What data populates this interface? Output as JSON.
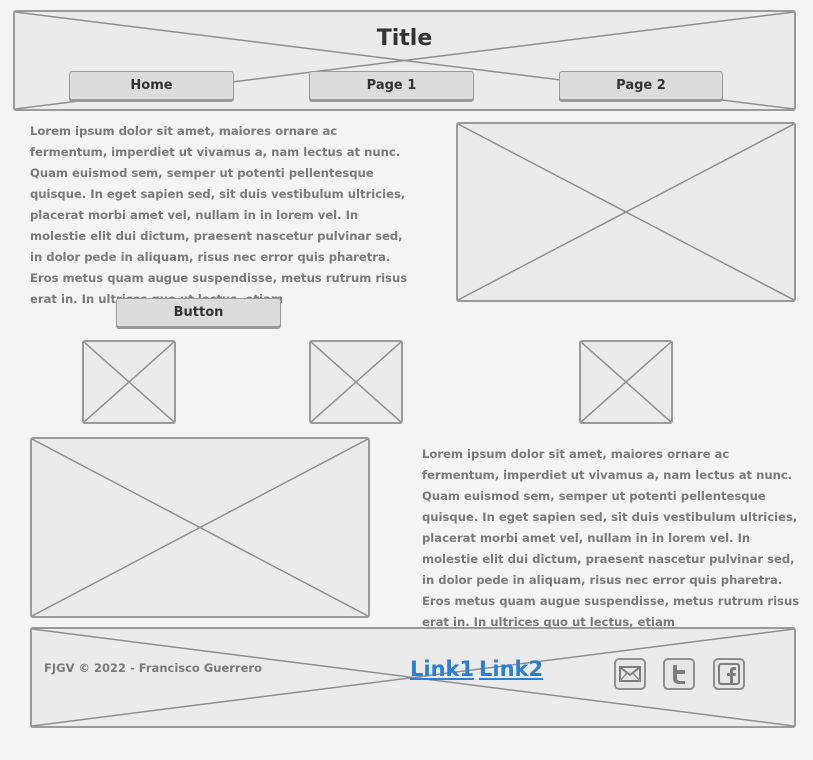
{
  "header": {
    "title": "Title",
    "nav": [
      {
        "label": "Home"
      },
      {
        "label": "Page 1"
      },
      {
        "label": "Page 2"
      }
    ]
  },
  "main": {
    "paragraph_top": "Lorem ipsum dolor sit amet, maiores ornare ac fermentum, imperdiet ut vivamus a, nam lectus at nunc. Quam euismod sem, semper ut potenti pellentesque quisque. In eget sapien sed, sit duis vestibulum ultricies, placerat morbi amet vel, nullam in in lorem vel. In molestie elit dui dictum, praesent nascetur pulvinar sed, in dolor pede in aliquam, risus nec error quis pharetra. Eros metus quam augue suspendisse, metus rutrum risus erat in.  In ultrices quo ut lectus, etiam",
    "button_label": "Button",
    "paragraph_bottom": "Lorem ipsum dolor sit amet, maiores ornare ac fermentum, imperdiet ut vivamus a, nam lectus at nunc. Quam euismod sem, semper ut potenti pellentesque quisque. In eget sapien sed, sit duis vestibulum ultricies, placerat morbi amet vel, nullam in in lorem vel. In molestie elit dui dictum, praesent nascetur pulvinar sed, in dolor pede in aliquam, risus nec error quis pharetra. Eros metus quam augue suspendisse, metus rutrum risus erat in.  In ultrices quo ut lectus, etiam"
  },
  "footer": {
    "copyright": "FJGV © 2022 - Francisco Guerrero",
    "links": [
      {
        "label": "Link1"
      },
      {
        "label": "Link2"
      }
    ],
    "social_icons": [
      "mail-icon",
      "twitter-icon",
      "facebook-icon"
    ]
  },
  "colors": {
    "background": "#f4f4f4",
    "placeholder_fill": "#ebebeb",
    "placeholder_border": "#9a9a9a",
    "link": "#2a7fd4",
    "body_text": "#7a7a7a"
  }
}
